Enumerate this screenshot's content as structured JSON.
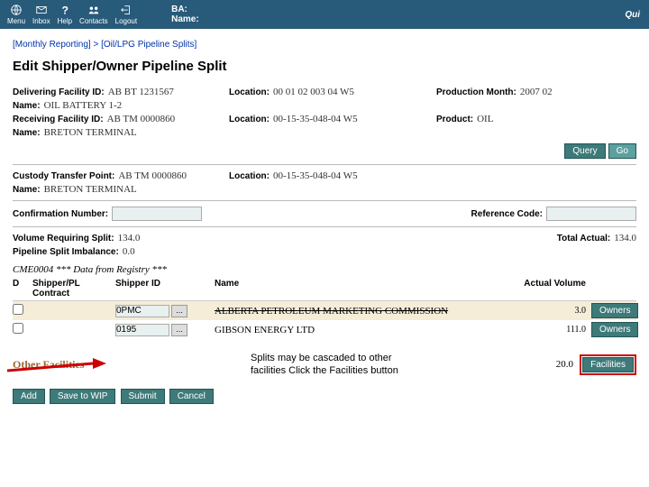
{
  "topbar": {
    "menu": "Menu",
    "inbox": "Inbox",
    "help": "Help",
    "contacts": "Contacts",
    "logout": "Logout",
    "ba_label": "BA:",
    "name_label": "Name:",
    "qui": "Qui"
  },
  "breadcrumb": {
    "a": "[Monthly Reporting]",
    "sep": ">",
    "b": "[Oil/LPG Pipeline Splits]"
  },
  "title": "Edit Shipper/Owner Pipeline Split",
  "deliver": {
    "lbl": "Delivering Facility ID:",
    "val": "AB BT 1231567",
    "loc_lbl": "Location:",
    "loc_val": "00 01 02 003 04 W5",
    "pm_lbl": "Production Month:",
    "pm_val": "2007 02",
    "name_lbl": "Name:",
    "name_val": "OIL BATTERY 1-2"
  },
  "receive": {
    "lbl": "Receiving Facility ID:",
    "val": "AB TM 0000860",
    "loc_lbl": "Location:",
    "loc_val": "00-15-35-048-04 W5",
    "prod_lbl": "Product:",
    "prod_val": "OIL",
    "name_lbl": "Name:",
    "name_val": "BRETON TERMINAL"
  },
  "buttons": {
    "query": "Query",
    "go": "Go",
    "owners": "Owners",
    "facilities": "Facilities",
    "add": "Add",
    "save_wip": "Save to WIP",
    "submit": "Submit",
    "cancel": "Cancel"
  },
  "ctp": {
    "lbl": "Custody Transfer Point:",
    "val": "AB TM 0000860",
    "loc_lbl": "Location:",
    "loc_val": "00-15-35-048-04 W5",
    "name_lbl": "Name:",
    "name_val": "BRETON TERMINAL"
  },
  "conf": {
    "lbl": "Confirmation Number:",
    "ref_lbl": "Reference Code:"
  },
  "vol": {
    "vrs_lbl": "Volume Requiring Split:",
    "vrs_val": "134.0",
    "ta_lbl": "Total Actual:",
    "ta_val": "134.0",
    "psi_lbl": "Pipeline Split Imbalance:",
    "psi_val": "0.0"
  },
  "cme": "CME0004 *** Data from Registry ***",
  "headers": {
    "d": "D",
    "sp": "Shipper/PL Contract",
    "id": "Shipper ID",
    "nm": "Name",
    "av": "Actual Volume"
  },
  "rows": [
    {
      "id": "0PMC",
      "name": "ALBERTA PETROLEUM MARKETING COMMISSION",
      "av": "3.0"
    },
    {
      "id": "0195",
      "name": "GIBSON ENERGY LTD",
      "av": "111.0"
    }
  ],
  "other_fac": {
    "label": "Other Facilities",
    "amount": "20.0"
  },
  "callout": "Splits may be cascaded to other facilities Click the Facilities button"
}
